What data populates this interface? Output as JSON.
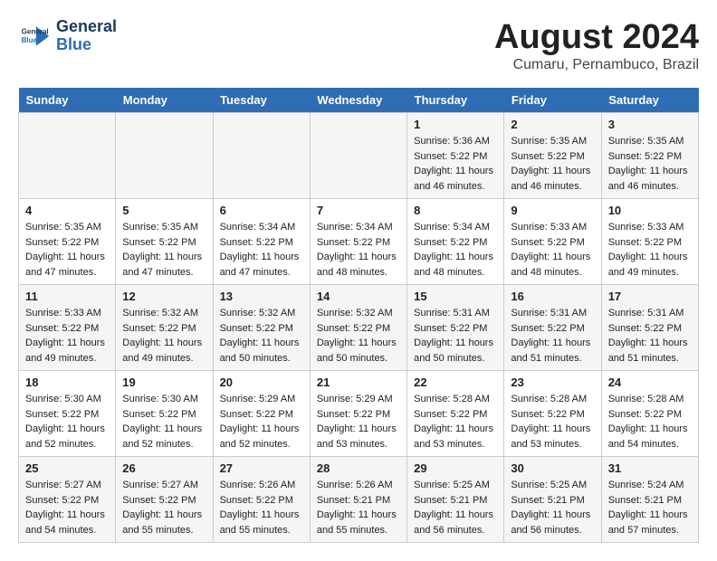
{
  "header": {
    "logo_line1": "General",
    "logo_line2": "Blue",
    "month_title": "August 2024",
    "location": "Cumaru, Pernambuco, Brazil"
  },
  "weekdays": [
    "Sunday",
    "Monday",
    "Tuesday",
    "Wednesday",
    "Thursday",
    "Friday",
    "Saturday"
  ],
  "weeks": [
    [
      {
        "day": "",
        "sunrise": "",
        "sunset": "",
        "daylight": ""
      },
      {
        "day": "",
        "sunrise": "",
        "sunset": "",
        "daylight": ""
      },
      {
        "day": "",
        "sunrise": "",
        "sunset": "",
        "daylight": ""
      },
      {
        "day": "",
        "sunrise": "",
        "sunset": "",
        "daylight": ""
      },
      {
        "day": "1",
        "sunrise": "Sunrise: 5:36 AM",
        "sunset": "Sunset: 5:22 PM",
        "daylight": "Daylight: 11 hours and 46 minutes."
      },
      {
        "day": "2",
        "sunrise": "Sunrise: 5:35 AM",
        "sunset": "Sunset: 5:22 PM",
        "daylight": "Daylight: 11 hours and 46 minutes."
      },
      {
        "day": "3",
        "sunrise": "Sunrise: 5:35 AM",
        "sunset": "Sunset: 5:22 PM",
        "daylight": "Daylight: 11 hours and 46 minutes."
      }
    ],
    [
      {
        "day": "4",
        "sunrise": "Sunrise: 5:35 AM",
        "sunset": "Sunset: 5:22 PM",
        "daylight": "Daylight: 11 hours and 47 minutes."
      },
      {
        "day": "5",
        "sunrise": "Sunrise: 5:35 AM",
        "sunset": "Sunset: 5:22 PM",
        "daylight": "Daylight: 11 hours and 47 minutes."
      },
      {
        "day": "6",
        "sunrise": "Sunrise: 5:34 AM",
        "sunset": "Sunset: 5:22 PM",
        "daylight": "Daylight: 11 hours and 47 minutes."
      },
      {
        "day": "7",
        "sunrise": "Sunrise: 5:34 AM",
        "sunset": "Sunset: 5:22 PM",
        "daylight": "Daylight: 11 hours and 48 minutes."
      },
      {
        "day": "8",
        "sunrise": "Sunrise: 5:34 AM",
        "sunset": "Sunset: 5:22 PM",
        "daylight": "Daylight: 11 hours and 48 minutes."
      },
      {
        "day": "9",
        "sunrise": "Sunrise: 5:33 AM",
        "sunset": "Sunset: 5:22 PM",
        "daylight": "Daylight: 11 hours and 48 minutes."
      },
      {
        "day": "10",
        "sunrise": "Sunrise: 5:33 AM",
        "sunset": "Sunset: 5:22 PM",
        "daylight": "Daylight: 11 hours and 49 minutes."
      }
    ],
    [
      {
        "day": "11",
        "sunrise": "Sunrise: 5:33 AM",
        "sunset": "Sunset: 5:22 PM",
        "daylight": "Daylight: 11 hours and 49 minutes."
      },
      {
        "day": "12",
        "sunrise": "Sunrise: 5:32 AM",
        "sunset": "Sunset: 5:22 PM",
        "daylight": "Daylight: 11 hours and 49 minutes."
      },
      {
        "day": "13",
        "sunrise": "Sunrise: 5:32 AM",
        "sunset": "Sunset: 5:22 PM",
        "daylight": "Daylight: 11 hours and 50 minutes."
      },
      {
        "day": "14",
        "sunrise": "Sunrise: 5:32 AM",
        "sunset": "Sunset: 5:22 PM",
        "daylight": "Daylight: 11 hours and 50 minutes."
      },
      {
        "day": "15",
        "sunrise": "Sunrise: 5:31 AM",
        "sunset": "Sunset: 5:22 PM",
        "daylight": "Daylight: 11 hours and 50 minutes."
      },
      {
        "day": "16",
        "sunrise": "Sunrise: 5:31 AM",
        "sunset": "Sunset: 5:22 PM",
        "daylight": "Daylight: 11 hours and 51 minutes."
      },
      {
        "day": "17",
        "sunrise": "Sunrise: 5:31 AM",
        "sunset": "Sunset: 5:22 PM",
        "daylight": "Daylight: 11 hours and 51 minutes."
      }
    ],
    [
      {
        "day": "18",
        "sunrise": "Sunrise: 5:30 AM",
        "sunset": "Sunset: 5:22 PM",
        "daylight": "Daylight: 11 hours and 52 minutes."
      },
      {
        "day": "19",
        "sunrise": "Sunrise: 5:30 AM",
        "sunset": "Sunset: 5:22 PM",
        "daylight": "Daylight: 11 hours and 52 minutes."
      },
      {
        "day": "20",
        "sunrise": "Sunrise: 5:29 AM",
        "sunset": "Sunset: 5:22 PM",
        "daylight": "Daylight: 11 hours and 52 minutes."
      },
      {
        "day": "21",
        "sunrise": "Sunrise: 5:29 AM",
        "sunset": "Sunset: 5:22 PM",
        "daylight": "Daylight: 11 hours and 53 minutes."
      },
      {
        "day": "22",
        "sunrise": "Sunrise: 5:28 AM",
        "sunset": "Sunset: 5:22 PM",
        "daylight": "Daylight: 11 hours and 53 minutes."
      },
      {
        "day": "23",
        "sunrise": "Sunrise: 5:28 AM",
        "sunset": "Sunset: 5:22 PM",
        "daylight": "Daylight: 11 hours and 53 minutes."
      },
      {
        "day": "24",
        "sunrise": "Sunrise: 5:28 AM",
        "sunset": "Sunset: 5:22 PM",
        "daylight": "Daylight: 11 hours and 54 minutes."
      }
    ],
    [
      {
        "day": "25",
        "sunrise": "Sunrise: 5:27 AM",
        "sunset": "Sunset: 5:22 PM",
        "daylight": "Daylight: 11 hours and 54 minutes."
      },
      {
        "day": "26",
        "sunrise": "Sunrise: 5:27 AM",
        "sunset": "Sunset: 5:22 PM",
        "daylight": "Daylight: 11 hours and 55 minutes."
      },
      {
        "day": "27",
        "sunrise": "Sunrise: 5:26 AM",
        "sunset": "Sunset: 5:22 PM",
        "daylight": "Daylight: 11 hours and 55 minutes."
      },
      {
        "day": "28",
        "sunrise": "Sunrise: 5:26 AM",
        "sunset": "Sunset: 5:21 PM",
        "daylight": "Daylight: 11 hours and 55 minutes."
      },
      {
        "day": "29",
        "sunrise": "Sunrise: 5:25 AM",
        "sunset": "Sunset: 5:21 PM",
        "daylight": "Daylight: 11 hours and 56 minutes."
      },
      {
        "day": "30",
        "sunrise": "Sunrise: 5:25 AM",
        "sunset": "Sunset: 5:21 PM",
        "daylight": "Daylight: 11 hours and 56 minutes."
      },
      {
        "day": "31",
        "sunrise": "Sunrise: 5:24 AM",
        "sunset": "Sunset: 5:21 PM",
        "daylight": "Daylight: 11 hours and 57 minutes."
      }
    ]
  ]
}
